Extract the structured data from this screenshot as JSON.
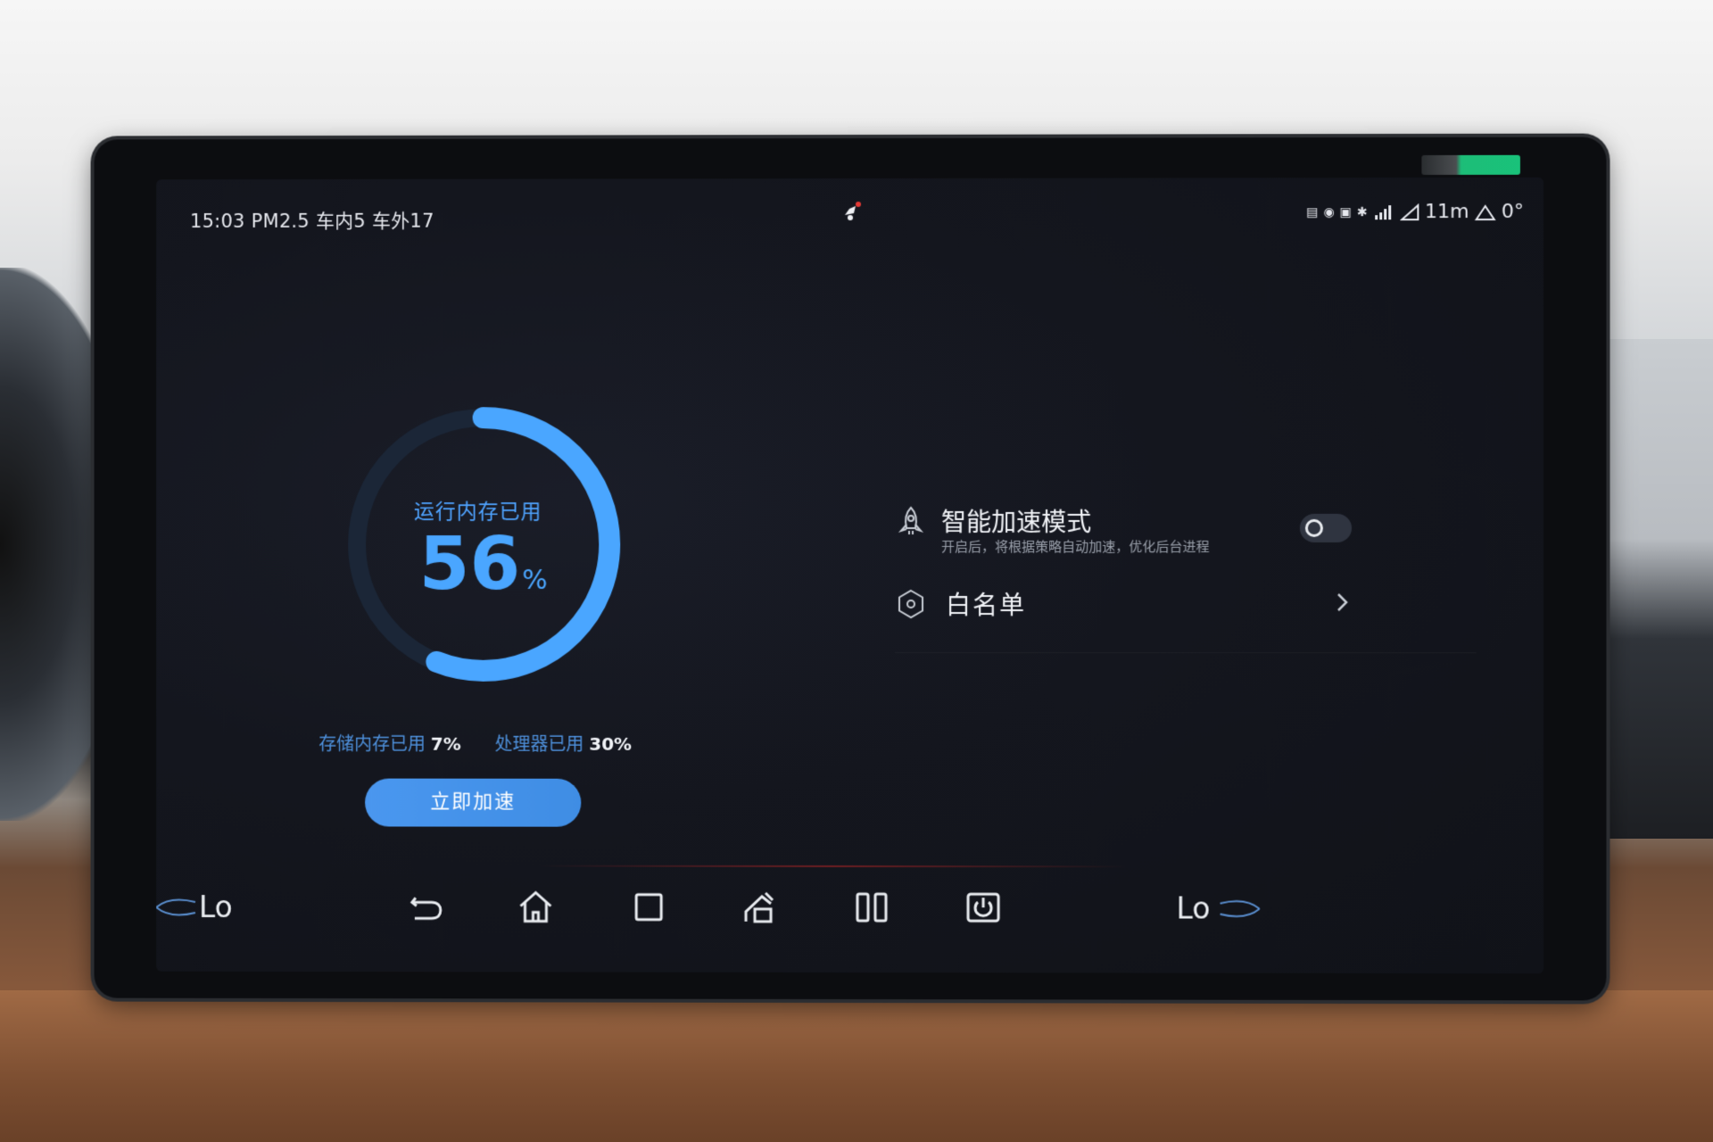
{
  "status_bar": {
    "left_text": "15:03 PM2.5 车内5 车外17",
    "altitude": "11m",
    "slope": "0°"
  },
  "memory": {
    "label": "运行内存已用",
    "percent": 56,
    "percent_text": "56",
    "unit": "%"
  },
  "stats": {
    "storage_label": "存储内存已用",
    "storage_value": "7%",
    "cpu_label": "处理器已用",
    "cpu_value": "30%"
  },
  "boost_button": {
    "label": "立即加速"
  },
  "settings": {
    "smart_mode": {
      "title": "智能加速模式",
      "description": "开启后，将根据策略自动加速，优化后台进程",
      "enabled": false
    },
    "whitelist": {
      "title": "白名单"
    }
  },
  "navbar": {
    "left_temp": "Lo",
    "right_temp": "Lo",
    "icons": [
      "back-icon",
      "home-icon",
      "recents-icon",
      "climate-icon",
      "split-screen-icon",
      "power-icon"
    ]
  },
  "colors": {
    "accent": "#4aa6ff",
    "button": "#4a97ef",
    "screen_bg": "#14161e",
    "gauge_track": "#1d2a3d"
  }
}
